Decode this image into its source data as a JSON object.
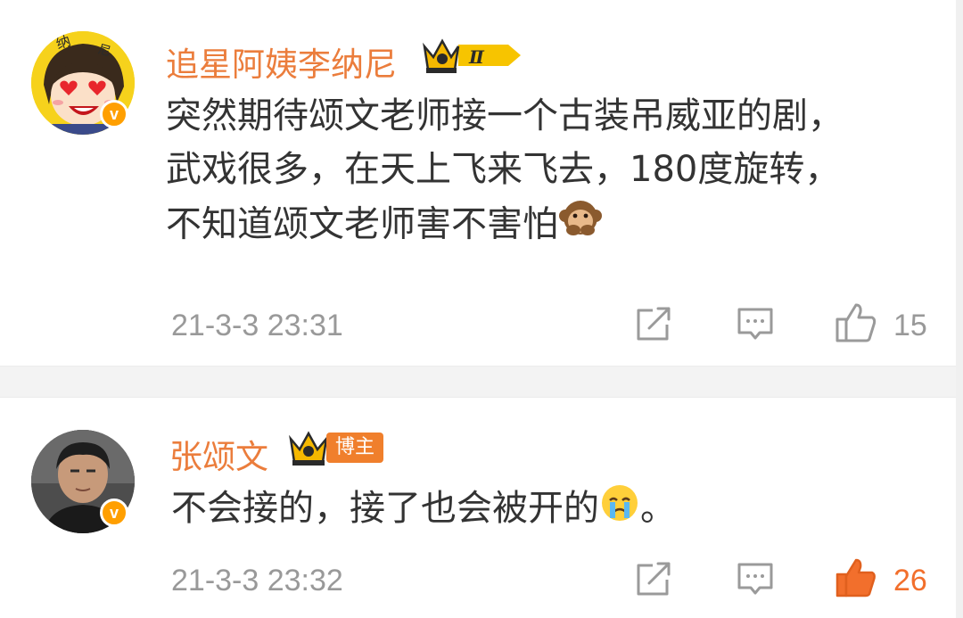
{
  "comments": [
    {
      "author": "追星阿姨李纳尼",
      "avatar_text": [
        "纳",
        "尼"
      ],
      "fan_badge": "Ⅱ",
      "verified_icon": "v",
      "text_lines": [
        "突然期待颂文老师接一个古装吊威亚的剧，",
        "武戏很多，在天上飞来飞去，180度旋转，",
        "不知道颂文老师害不害怕"
      ],
      "emoji": "see-no-evil-monkey-emoji",
      "time": "21-3-3 23:31",
      "like_count": "15",
      "liked": false
    },
    {
      "author": "张颂文",
      "author_badge": "博主",
      "verified_icon": "v",
      "text_before": "不会接的，接了也会被开的",
      "emoji": "crying-face-emoji",
      "text_after": "。",
      "time": "21-3-3 23:32",
      "like_count": "26",
      "liked": true
    }
  ],
  "colors": {
    "name": "#eb7d3c",
    "text": "#333333",
    "meta": "#999999",
    "like_active": "#f26f2c",
    "verified": "#ff9f00"
  }
}
